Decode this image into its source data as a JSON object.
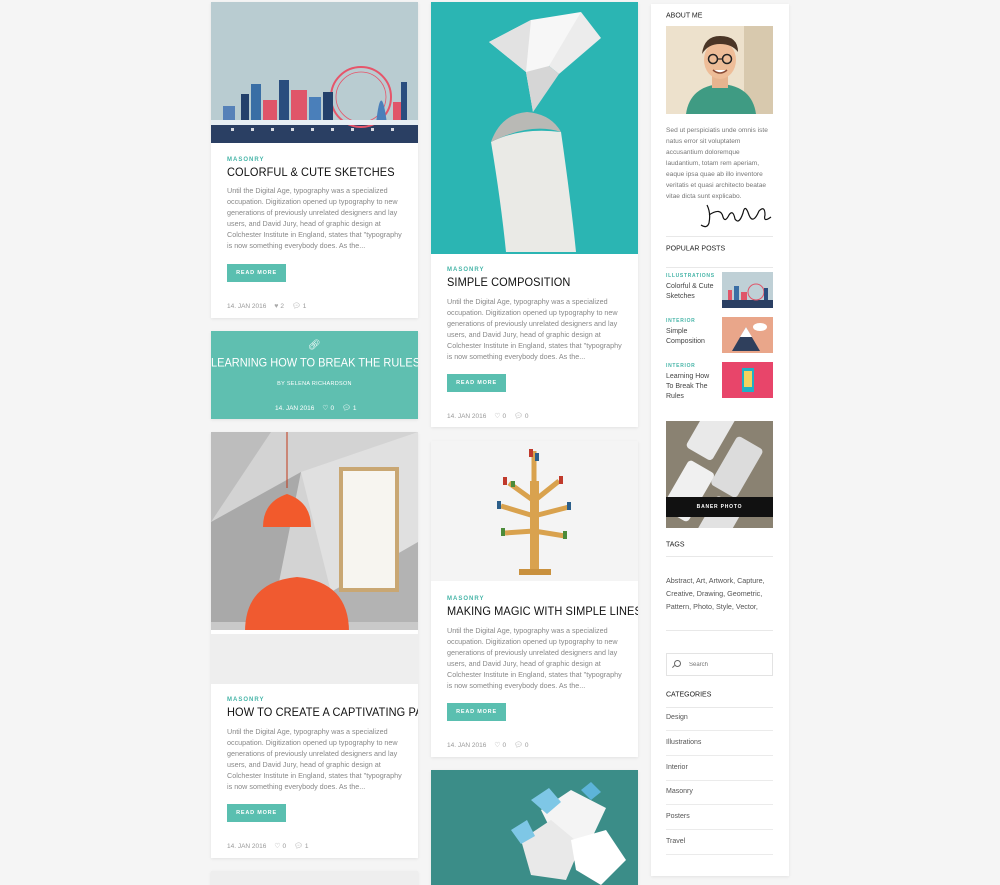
{
  "posts": {
    "p1": {
      "category": "MASONRY",
      "title": "COLORFUL & CUTE SKETCHES",
      "excerpt": "Until the Digital Age, typography was a specialized occupation. Digitization opened up typography to new generations of previously unrelated designers and lay users, and David Jury, head of graphic design at Colchester Institute in England, states that \"typography is now something everybody does. As the...",
      "button": "READ MORE",
      "date": "14. JAN 2016",
      "likes": "2",
      "comments": "1"
    },
    "p2": {
      "title": "LEARNING HOW TO BREAK THE RULES",
      "author": "BY SELENA RICHARDSON",
      "date": "14. JAN 2016",
      "likes": "0",
      "comments": "1"
    },
    "p3": {
      "category": "MASONRY",
      "title": "HOW TO CREATE A CAPTIVATING PACKAGE",
      "excerpt": "Until the Digital Age, typography was a specialized occupation. Digitization opened up typography to new generations of previously unrelated designers and lay users, and David Jury, head of graphic design at Colchester Institute in England, states that \"typography is now something everybody does. As the...",
      "button": "READ MORE",
      "date": "14. JAN 2016",
      "likes": "0",
      "comments": "1"
    },
    "p4": {
      "category": "MASONRY",
      "title": "SIMPLE COMPOSITION",
      "excerpt": "Until the Digital Age, typography was a specialized occupation. Digitization opened up typography to new generations of previously unrelated designers and lay users, and David Jury, head of graphic design at Colchester Institute in England, states that \"typography is now something everybody does. As the...",
      "button": "READ MORE",
      "date": "14. JAN 2016",
      "likes": "0",
      "comments": "0"
    },
    "p5": {
      "category": "MASONRY",
      "title": "MAKING MAGIC WITH SIMPLE LINES",
      "excerpt": "Until the Digital Age, typography was a specialized occupation. Digitization opened up typography to new generations of previously unrelated designers and lay users, and David Jury, head of graphic design at Colchester Institute in England, states that \"typography is now something everybody does. As the...",
      "button": "READ MORE",
      "date": "14. JAN 2016",
      "likes": "0",
      "comments": "0"
    }
  },
  "sidebar": {
    "about": {
      "heading": "ABOUT ME",
      "text": "Sed ut perspiciatis unde omnis iste natus error sit voluptatem accusantium doloremque laudantium, totam rem aperiam, eaque ipsa quae ab illo inventore veritatis et quasi architecto beatae vitae dicta sunt explicabo."
    },
    "popular": {
      "heading": "POPULAR POSTS",
      "items": [
        {
          "category": "ILLUSTRATIONS",
          "title": "Colorful & Cute Sketches"
        },
        {
          "category": "INTERIOR",
          "title": "Simple Composition"
        },
        {
          "category": "INTERIOR",
          "title": "Learning How To Break The Rules"
        }
      ]
    },
    "banner_label": "BANER PHOTO",
    "tags": {
      "heading": "TAGS",
      "text": "Abstract, Art, Artwork, Capture, Creative, Drawing, Geometric, Pattern, Photo, Style, Vector,"
    },
    "search": {
      "placeholder": "Search"
    },
    "categories": {
      "heading": "CATEGORIES",
      "items": [
        "Design",
        "Illustrations",
        "Interior",
        "Masonry",
        "Posters",
        "Travel"
      ]
    }
  },
  "colors": {
    "accent": "#5abfb0",
    "teal_bg": "#2bb5b3",
    "background": "#f5f5f5"
  }
}
